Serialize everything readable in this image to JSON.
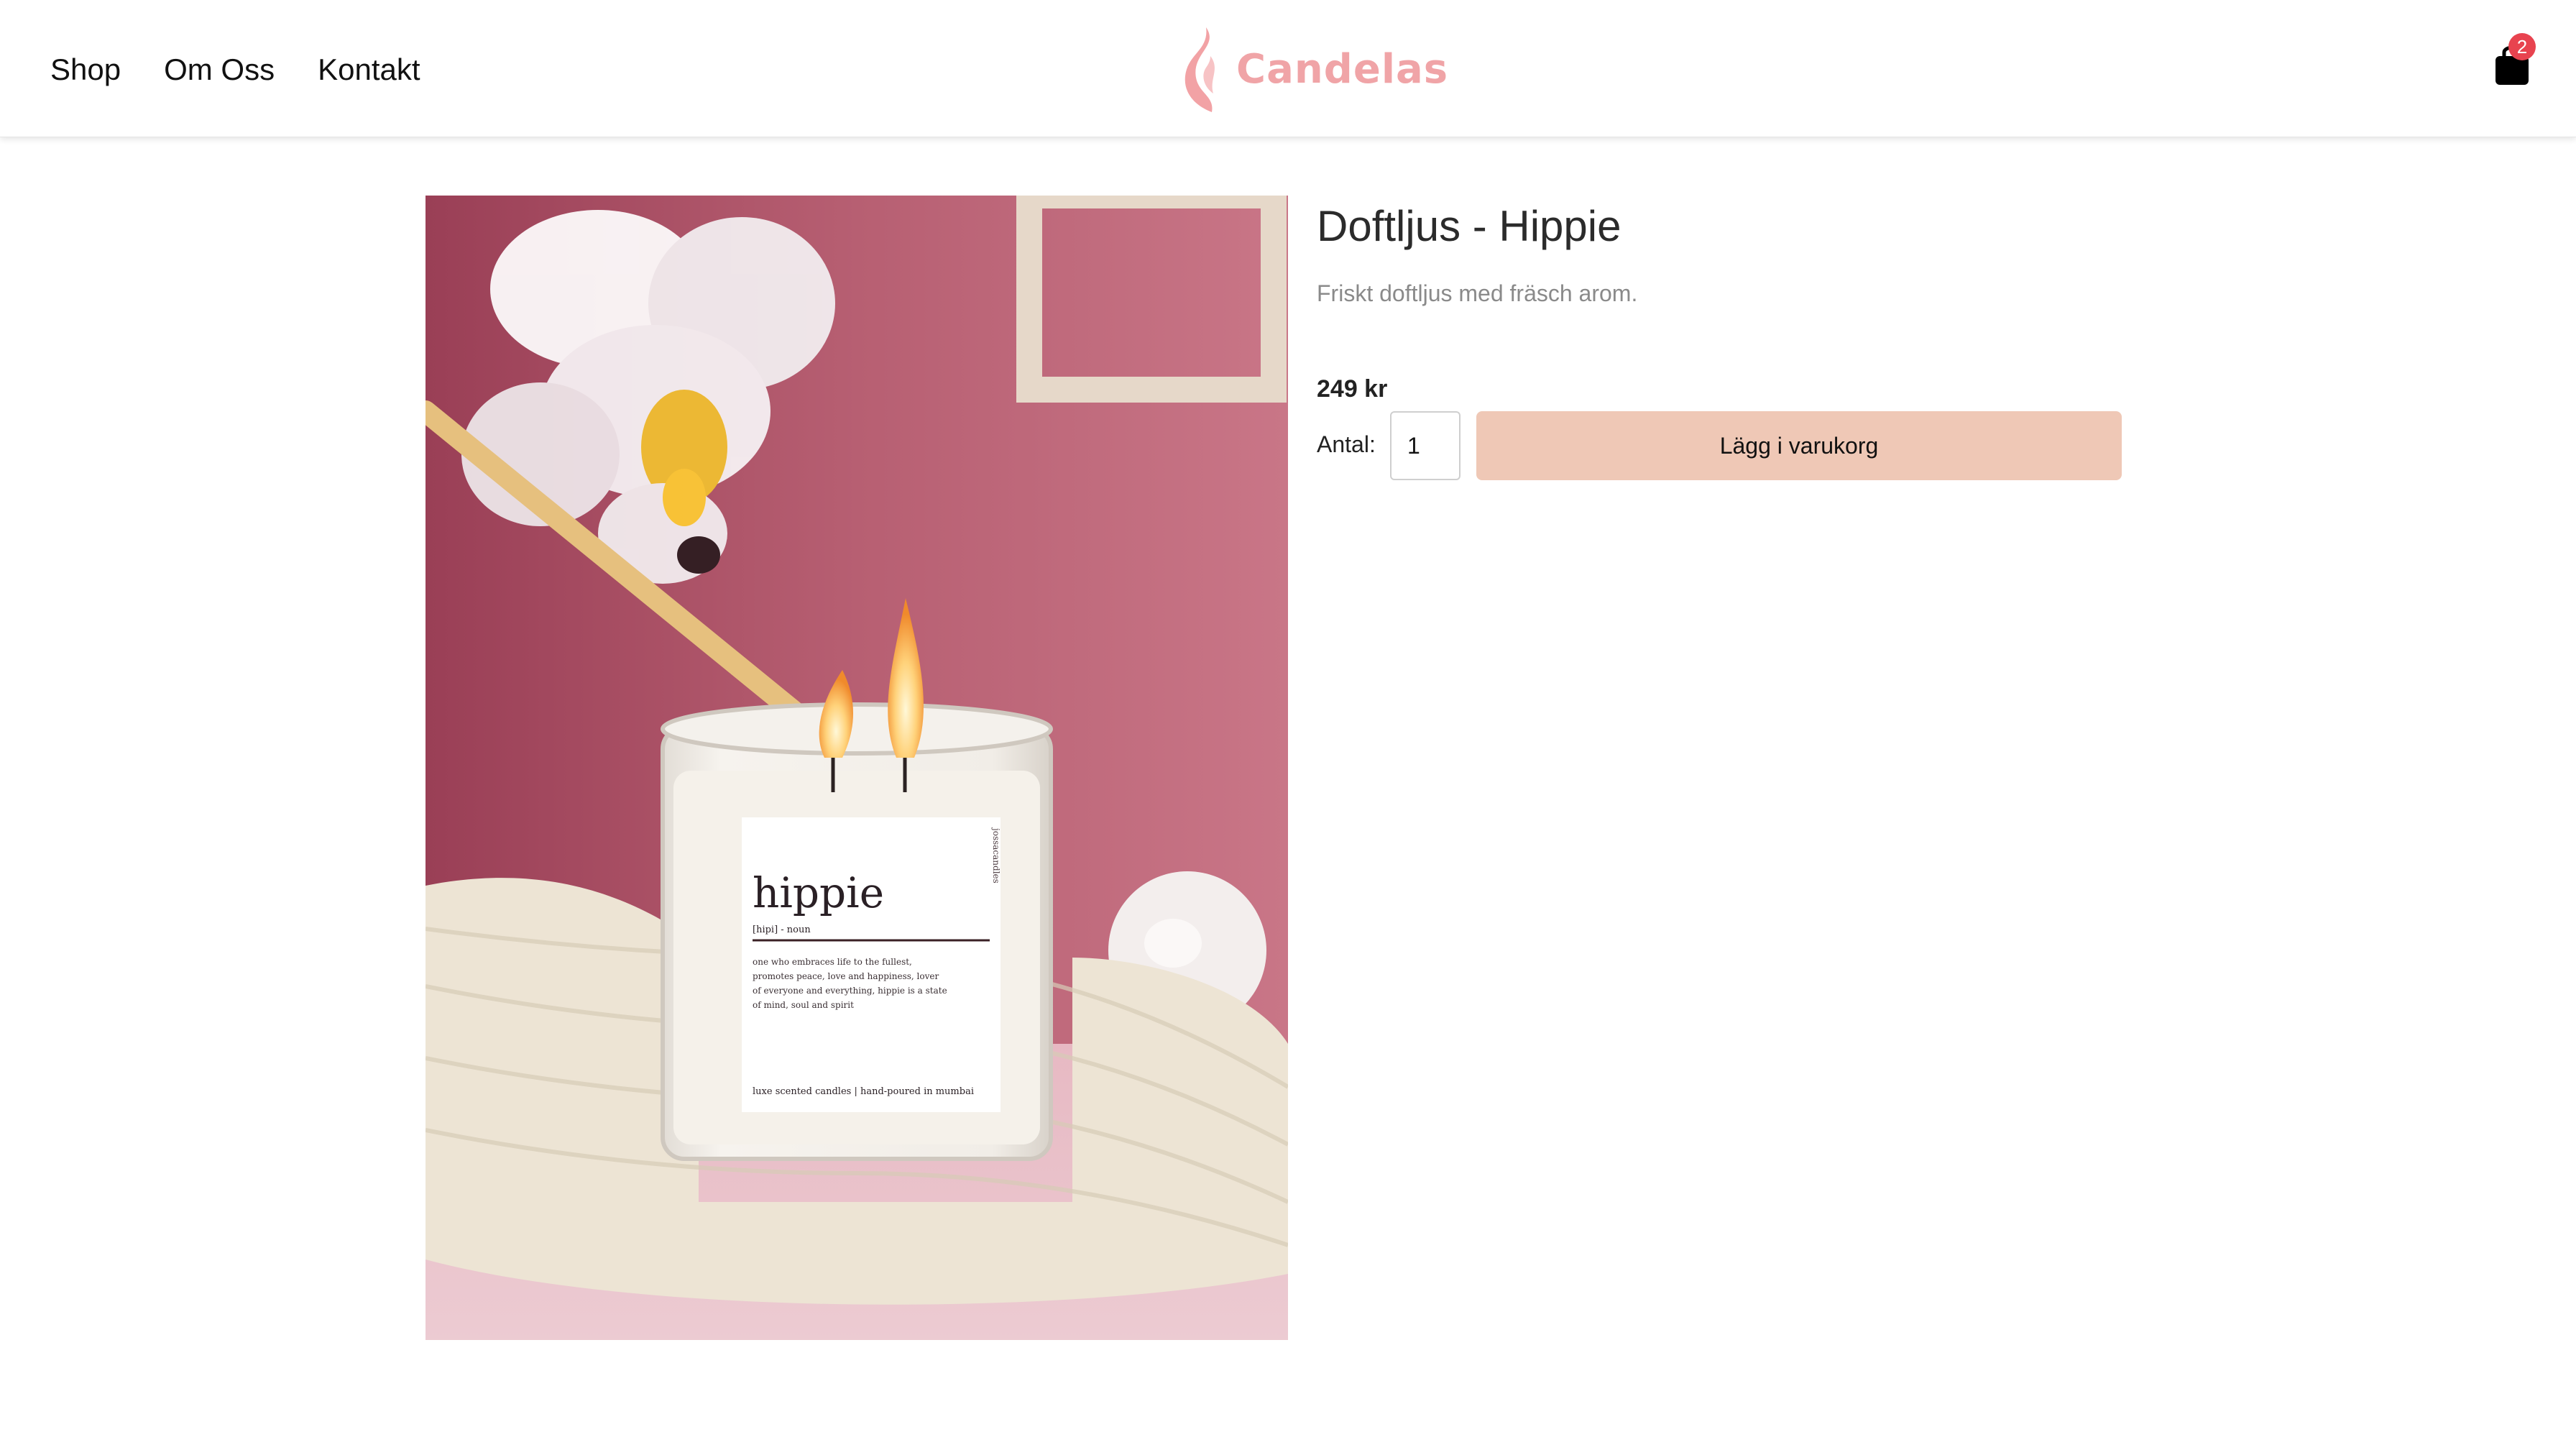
{
  "nav": {
    "items": [
      {
        "label": "Shop"
      },
      {
        "label": "Om Oss"
      },
      {
        "label": "Kontakt"
      }
    ]
  },
  "logo": {
    "text": "Candelas",
    "icon": "flame-icon",
    "color": "#f0a4a7"
  },
  "cart": {
    "icon": "shopping-bag-icon",
    "count": "2",
    "badge_color": "#e8434f"
  },
  "product": {
    "title": "Doftljus - Hippie",
    "description": "Friskt doftljus med fräsch arom.",
    "price": "249 kr",
    "quantity_label": "Antal:",
    "quantity_value": "1",
    "add_to_cart_label": "Lägg i varukorg",
    "button_color": "#efc8b6",
    "image": {
      "label_word": "hippie",
      "label_phonetic": "[hipi] - noun",
      "label_definition_lines": [
        "one who embraces life to the fullest,",
        "promotes peace, love and happiness, lover",
        "of everyone and everything, hippie is a state",
        "of mind, soul and spirit"
      ],
      "label_footer": "luxe scented candles | hand-poured in mumbai",
      "label_brand": "jossacandles"
    }
  }
}
